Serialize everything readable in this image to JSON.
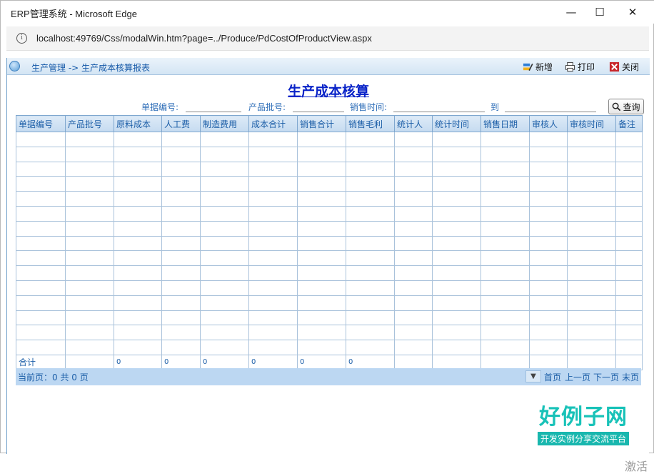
{
  "window": {
    "title": "ERP管理系统 - Microsoft Edge",
    "minimize": "—",
    "maximize": "☐",
    "close": "✕"
  },
  "address": {
    "url": "localhost:49769/Css/modalWin.htm?page=../Produce/PdCostOfProductView.aspx"
  },
  "toolbar": {
    "breadcrumb": "生产管理 -> 生产成本核算报表",
    "add_label": "新增",
    "print_label": "打印",
    "close_label": "关闭"
  },
  "page": {
    "title": "生产成本核算"
  },
  "search": {
    "doc_no_label": "单据编号:",
    "batch_label": "产品批号:",
    "sale_time_label": "销售时间:",
    "to_label": "到",
    "query_label": "查询"
  },
  "table": {
    "columns": [
      "单据编号",
      "产品批号",
      "原料成本",
      "人工费",
      "制造费用",
      "成本合计",
      "销售合计",
      "销售毛利",
      "统计人",
      "统计时间",
      "销售日期",
      "审核人",
      "审核时间",
      "备注"
    ],
    "total_row": [
      "合计",
      "",
      "0",
      "0",
      "0",
      "0",
      "0",
      "0",
      "",
      "",
      "",
      "",
      "",
      ""
    ]
  },
  "pager": {
    "info": "当前页：0 共 0 页",
    "first": "首页",
    "prev": "上一页",
    "next": "下一页",
    "last": "末页"
  },
  "watermark": {
    "brand": "好例子网",
    "slogan": "开发实例分享交流平台",
    "activate": "激活"
  }
}
